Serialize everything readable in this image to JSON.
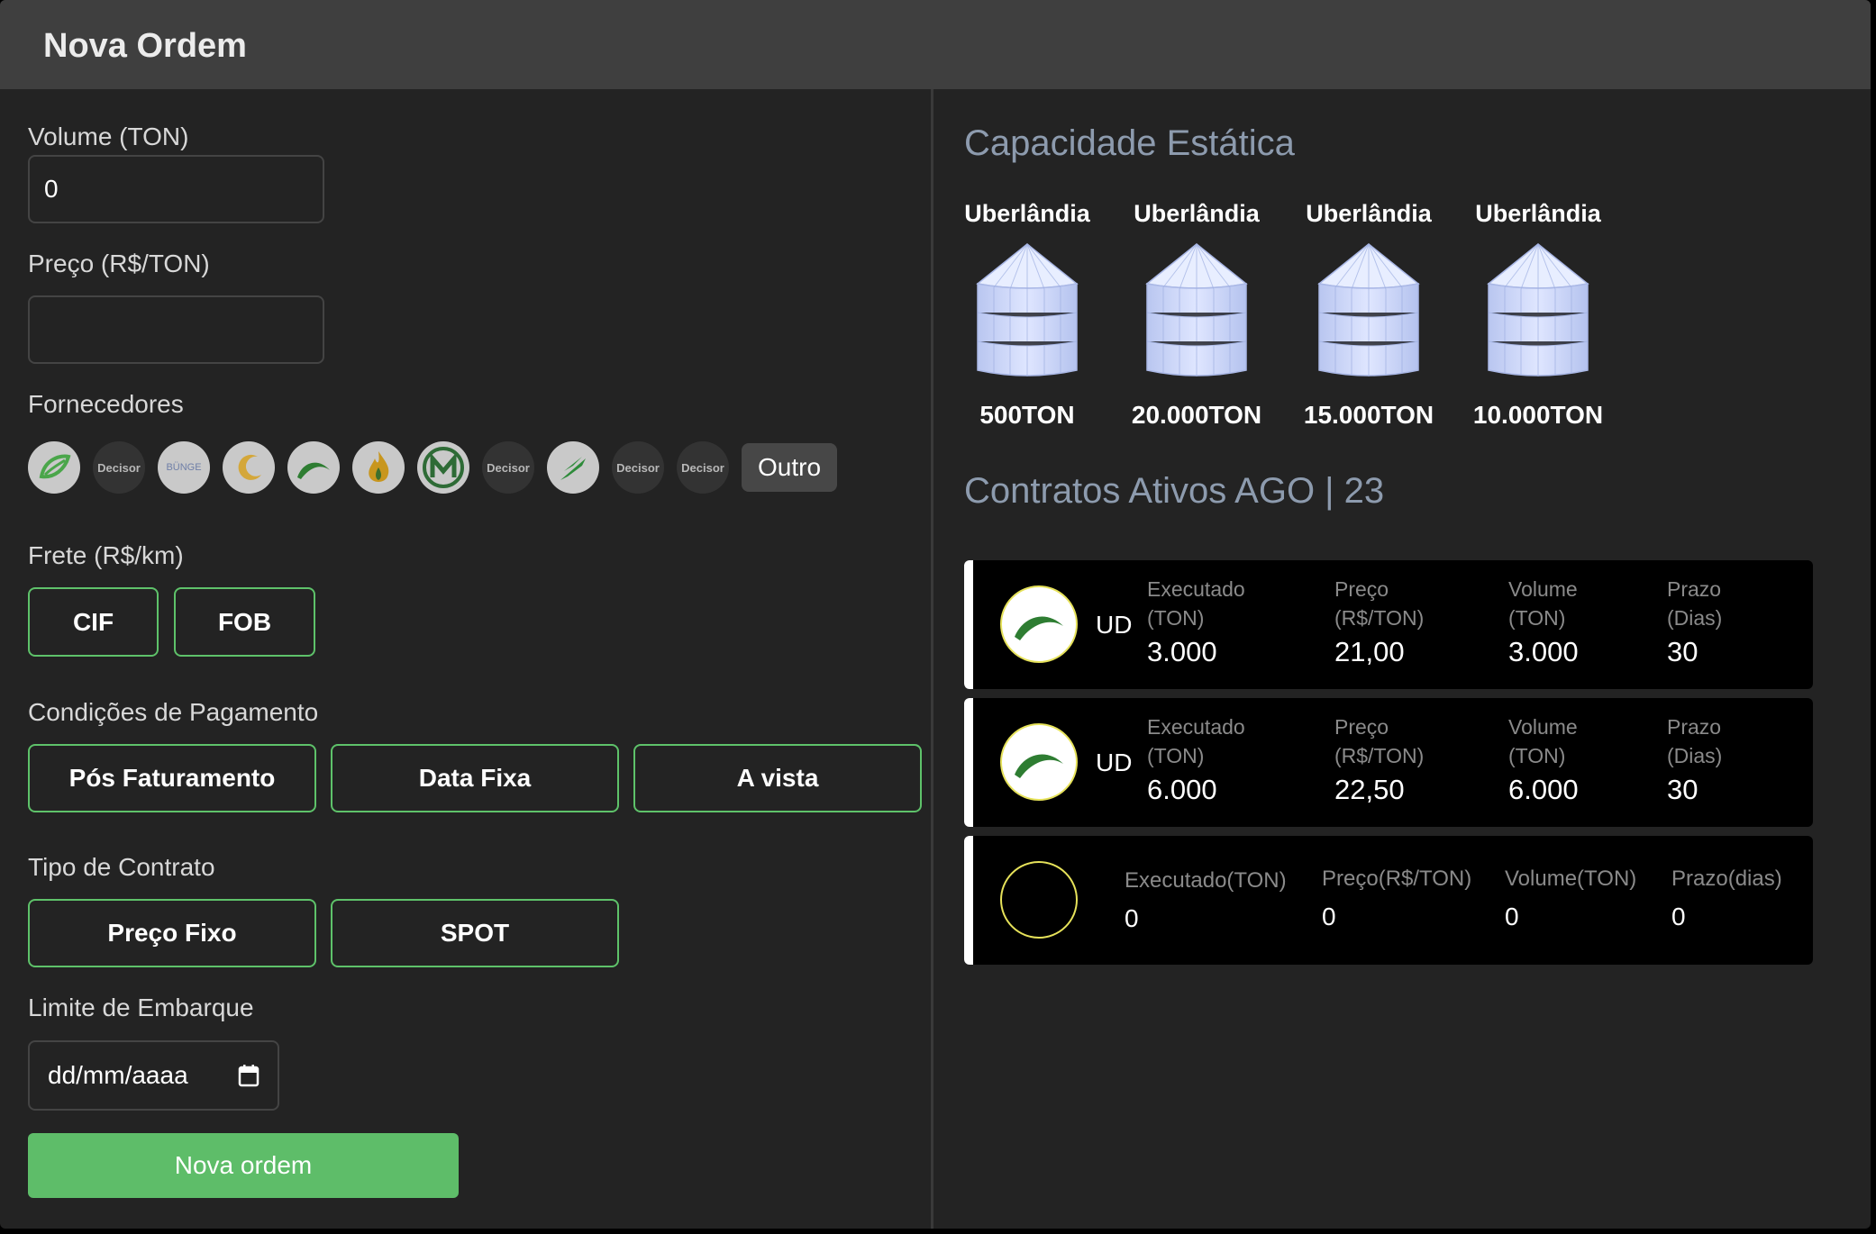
{
  "header": {
    "title": "Nova Ordem"
  },
  "form": {
    "volume": {
      "label": "Volume (TON)",
      "value": "0"
    },
    "preco": {
      "label": "Preço (R$/TON)",
      "value": ""
    },
    "fornecedores": {
      "label": "Fornecedores",
      "logos": [
        "Decisor",
        "BÜNGE",
        "Decisor",
        "Decisor",
        "Decisor"
      ],
      "outro_label": "Outro"
    },
    "frete": {
      "label": "Frete (R$/km)",
      "options": [
        "CIF",
        "FOB"
      ]
    },
    "pagamento": {
      "label": "Condições de Pagamento",
      "options": [
        "Pós Faturamento",
        "Data Fixa",
        "A vista"
      ]
    },
    "contrato": {
      "label": "Tipo de Contrato",
      "options": [
        "Preço Fixo",
        "SPOT"
      ]
    },
    "embarque": {
      "label": "Limite de Embarque",
      "placeholder": "dd/mm/aaaa"
    },
    "submit_label": "Nova ordem"
  },
  "capacity": {
    "title": "Capacidade Estática",
    "silos": [
      {
        "city": "Uberlândia",
        "capacity": "500TON"
      },
      {
        "city": "Uberlândia",
        "capacity": "20.000TON"
      },
      {
        "city": "Uberlândia",
        "capacity": "15.000TON"
      },
      {
        "city": "Uberlândia",
        "capacity": "10.000TON"
      }
    ]
  },
  "contracts": {
    "title": "Contratos Ativos AGO | 23",
    "items": [
      {
        "supplier": "UD",
        "executado_label": "Executado (TON)",
        "executado": "3.000",
        "preco_label": "Preço (R$/TON)",
        "preco": "21,00",
        "volume_label": "Volume (TON)",
        "volume": "3.000",
        "prazo_label": "Prazo (Dias)",
        "prazo": "30"
      },
      {
        "supplier": "UD",
        "executado_label": "Executado (TON)",
        "executado": "6.000",
        "preco_label": "Preço (R$/TON)",
        "preco": "22,50",
        "volume_label": "Volume (TON)",
        "volume": "6.000",
        "prazo_label": "Prazo (Dias)",
        "prazo": "30"
      },
      {
        "executado_label": "Executado(TON)",
        "executado": "0",
        "preco_label": "Preço(R$/TON)",
        "preco": "0",
        "volume_label": "Volume(TON)",
        "volume": "0",
        "prazo_label": "Prazo(dias)",
        "prazo": "0"
      }
    ]
  },
  "colors": {
    "accent": "#5ebd69",
    "panel": "#232323",
    "header": "#3f3f3f",
    "title_blue": "#8d9bae"
  }
}
